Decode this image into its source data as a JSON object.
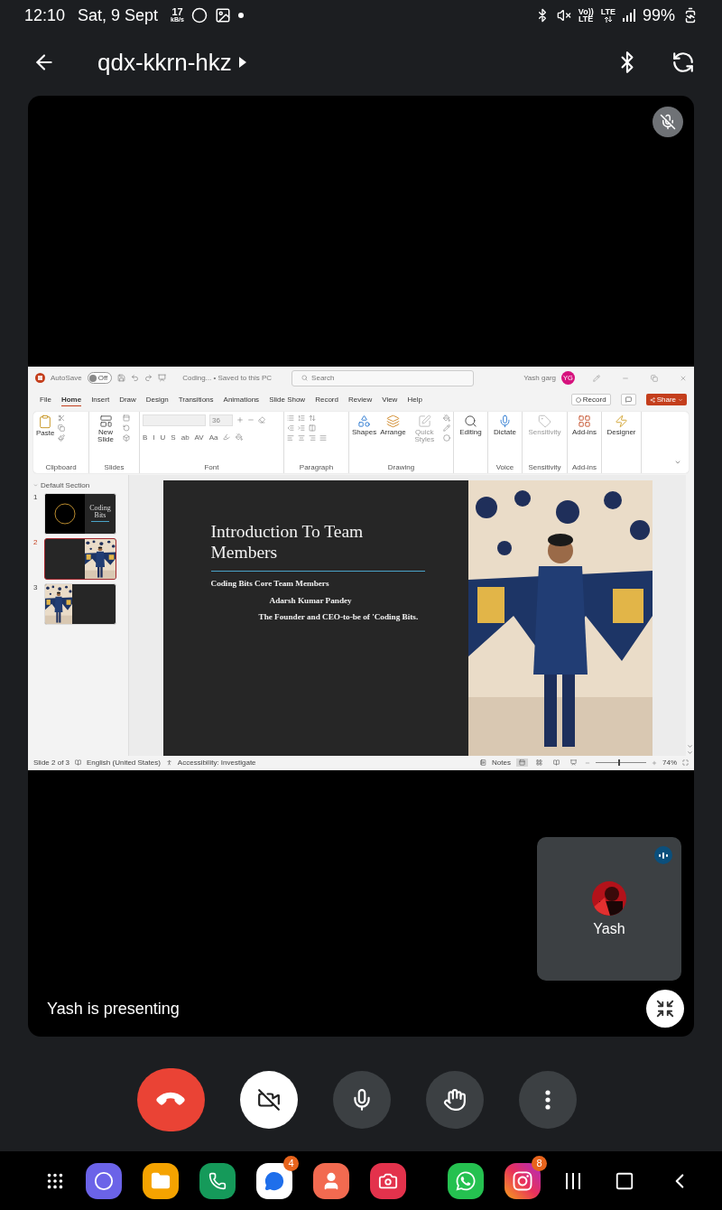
{
  "status_bar": {
    "time": "12:10",
    "date": "Sat, 9 Sept",
    "net_speed": "17",
    "net_unit": "kB/s",
    "volte_top": "Vo))",
    "volte_bottom": "LTE",
    "network": "LTE",
    "battery": "99%"
  },
  "app_bar": {
    "title": "qdx-kkrn-hkz"
  },
  "shared_screen": {
    "title_bar": {
      "autosave": "AutoSave",
      "autosave_toggle": "Off",
      "autosave_on": false,
      "document": "Coding... • Saved to this PC",
      "search_placeholder": "Search",
      "user": "Yash garg",
      "avatar_initials": "YG"
    },
    "tabs": [
      {
        "label": "File",
        "selected": false
      },
      {
        "label": "Home",
        "selected": true
      },
      {
        "label": "Insert",
        "selected": false
      },
      {
        "label": "Draw",
        "selected": false
      },
      {
        "label": "Design",
        "selected": false
      },
      {
        "label": "Transitions",
        "selected": false
      },
      {
        "label": "Animations",
        "selected": false
      },
      {
        "label": "Slide Show",
        "selected": false
      },
      {
        "label": "Record",
        "selected": false
      },
      {
        "label": "Review",
        "selected": false
      },
      {
        "label": "View",
        "selected": false
      },
      {
        "label": "Help",
        "selected": false
      }
    ],
    "record_button": "Record",
    "share_button": "Share",
    "ribbon": [
      {
        "kind": "clipboard",
        "label": "Clipboard",
        "button": "Paste"
      },
      {
        "kind": "slides",
        "label": "Slides",
        "button": "New Slide"
      },
      {
        "kind": "font",
        "label": "Font",
        "font_size": "36",
        "format_buttons": [
          "B",
          "I",
          "U",
          "S",
          "ab",
          "AV",
          "Aa"
        ]
      },
      {
        "kind": "paragraph",
        "label": "Paragraph"
      },
      {
        "kind": "drawing",
        "label": "Drawing",
        "buttons": [
          {
            "kind": "shapes",
            "label": "Shapes",
            "disabled": false
          },
          {
            "kind": "arrange",
            "label": "Arrange",
            "disabled": false
          },
          {
            "kind": "quick-styles",
            "label": "Quick Styles",
            "disabled": true
          }
        ]
      },
      {
        "kind": "single",
        "buttons": [
          {
            "kind": "editing",
            "label": "Editing",
            "disabled": false
          }
        ]
      },
      {
        "kind": "single",
        "label": "Voice",
        "buttons": [
          {
            "kind": "dictate",
            "label": "Dictate",
            "disabled": false
          }
        ]
      },
      {
        "kind": "single",
        "label": "Sensitivity",
        "buttons": [
          {
            "kind": "sensitivity",
            "label": "Sensitivity",
            "disabled": true
          }
        ]
      },
      {
        "kind": "single",
        "label": "Add-ins",
        "buttons": [
          {
            "kind": "add-ins",
            "label": "Add-ins",
            "disabled": false
          }
        ]
      },
      {
        "kind": "single",
        "buttons": [
          {
            "kind": "designer",
            "label": "Designer",
            "disabled": false
          }
        ]
      }
    ],
    "section": "Default Section",
    "thumbnails": [
      {
        "number": "1",
        "kind": "logo",
        "text": "Coding Bits",
        "selected": false
      },
      {
        "number": "2",
        "kind": "photo-right",
        "selected": true
      },
      {
        "number": "3",
        "kind": "photo-left",
        "selected": false
      }
    ],
    "slide": {
      "title": "Introduction To Team Members",
      "lines": [
        {
          "kind": "heading",
          "text": "Coding Bits Core Team Members"
        },
        {
          "kind": "name",
          "text": "Adarsh Kumar Pandey"
        },
        {
          "kind": "role",
          "text": "The Founder and CEO-to-be of 'Coding Bits."
        }
      ]
    },
    "status": {
      "slide_count": "Slide 2 of 3",
      "language": "English (United States)",
      "accessibility": "Accessibility: Investigate",
      "notes": "Notes",
      "views": [
        {
          "kind": "normal",
          "selected": true
        },
        {
          "kind": "sorter",
          "selected": false
        },
        {
          "kind": "reading",
          "selected": false
        },
        {
          "kind": "show",
          "selected": false
        }
      ],
      "zoom": "74%",
      "zoom_slider": {
        "level": 0.45
      }
    }
  },
  "presenter_label": "Yash is presenting",
  "participant": {
    "name": "Yash",
    "speaking": true
  },
  "dock": [
    {
      "kind": "browser"
    },
    {
      "kind": "files"
    },
    {
      "kind": "phone"
    },
    {
      "kind": "messages",
      "badge": "4"
    },
    {
      "kind": "contacts"
    },
    {
      "kind": "camera"
    },
    {
      "kind": "divider"
    },
    {
      "kind": "whatsapp"
    },
    {
      "kind": "instagram",
      "badge": "8"
    }
  ]
}
